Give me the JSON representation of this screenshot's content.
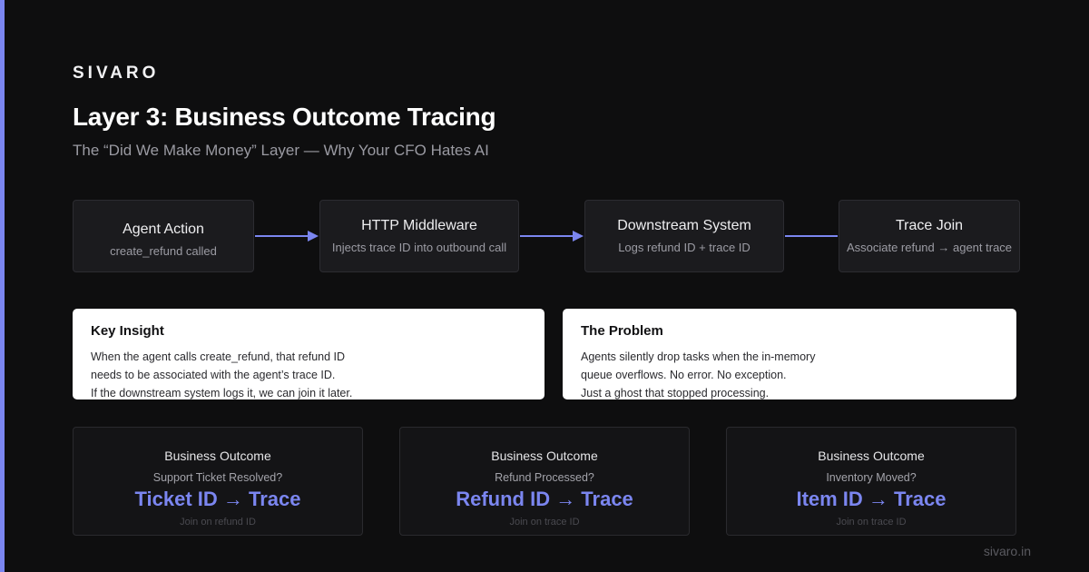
{
  "brand": "SIVARO",
  "title": "Layer 3: Business Outcome Tracing",
  "subtitle": "The “Did We Make Money” Layer — Why Your CFO Hates AI",
  "flow": [
    {
      "title": "Agent Action",
      "desc": "create_refund called"
    },
    {
      "title": "HTTP Middleware",
      "desc": "Injects trace ID into outbound call"
    },
    {
      "title": "Downstream System",
      "desc": "Logs refund ID + trace ID"
    },
    {
      "title": "Trace Join",
      "desc": "Associate refund → agent trace"
    }
  ],
  "insight": {
    "title": "Key Insight",
    "lines": [
      "When the agent calls create_refund, that refund ID",
      "needs to be associated with the agent’s trace ID.",
      "If the downstream system logs it, we can join it later."
    ]
  },
  "problem": {
    "title": "The Problem",
    "lines": [
      "Agents silently drop tasks when the in-memory",
      "queue overflows. No error. No exception.",
      "Just a ghost that stopped processing."
    ]
  },
  "outcomes": [
    {
      "label": "Business Outcome",
      "question": "Support Ticket Resolved?",
      "mapping": "Ticket ID → Trace",
      "join": "Join on refund ID"
    },
    {
      "label": "Business Outcome",
      "question": "Refund Processed?",
      "mapping": "Refund ID → Trace",
      "join": "Join on trace ID"
    },
    {
      "label": "Business Outcome",
      "question": "Inventory Moved?",
      "mapping": "Item ID → Trace",
      "join": "Join on trace ID"
    }
  ],
  "footer": "sivaro.in",
  "colors": {
    "accent": "#7b86f0",
    "background": "#0e0e0f"
  }
}
